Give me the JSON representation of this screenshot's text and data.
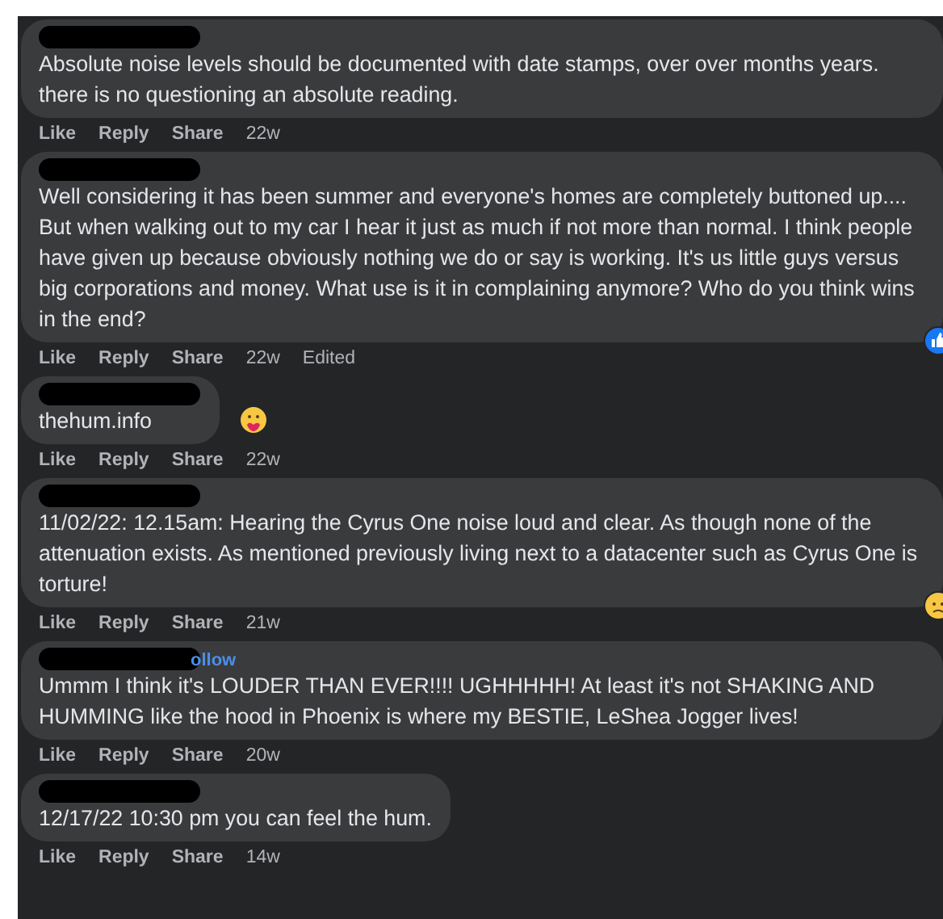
{
  "comments": [
    {
      "text": "Absolute noise levels should be documented with date stamps, over over months years. there is no questioning an absolute reading.",
      "actions": [
        "Like",
        "Reply",
        "Share"
      ],
      "time": "22w"
    },
    {
      "text": "Well considering it has been summer and everyone's homes are completely buttoned up.... But when walking out to my car I hear it just as much if not more than normal. I think people have given up because obviously nothing we do or say is working. It's us little guys versus big corporations and money. What use is it in complaining anymore? Who do you think wins in the end?",
      "actions": [
        "Like",
        "Reply",
        "Share"
      ],
      "time": "22w",
      "edited": "Edited",
      "reaction": {
        "kind": "like"
      }
    },
    {
      "text": "thehum.info",
      "actions": [
        "Like",
        "Reply",
        "Share"
      ],
      "time": "22w",
      "reaction": {
        "kind": "care"
      }
    },
    {
      "text": "11/02/22: 12.15am: Hearing the Cyrus One noise loud and clear. As though none of the attenuation exists. As mentioned previously living next to a datacenter such as Cyrus One is torture!",
      "actions": [
        "Like",
        "Reply",
        "Share"
      ],
      "time": "21w",
      "reaction": {
        "kind": "sad"
      }
    },
    {
      "text": "Ummm I think it's LOUDER THAN EVER!!!! UGHHHHH! At least it's not SHAKING AND HUMMING like the hood in Phoenix is where my BESTIE, LeShea Jogger lives!",
      "follow": "ollow",
      "actions": [
        "Like",
        "Reply",
        "Share"
      ],
      "time": "20w"
    },
    {
      "text": "12/17/22 10:30 pm you can feel the hum.",
      "actions": [
        "Like",
        "Reply",
        "Share"
      ],
      "time": "14w"
    }
  ]
}
